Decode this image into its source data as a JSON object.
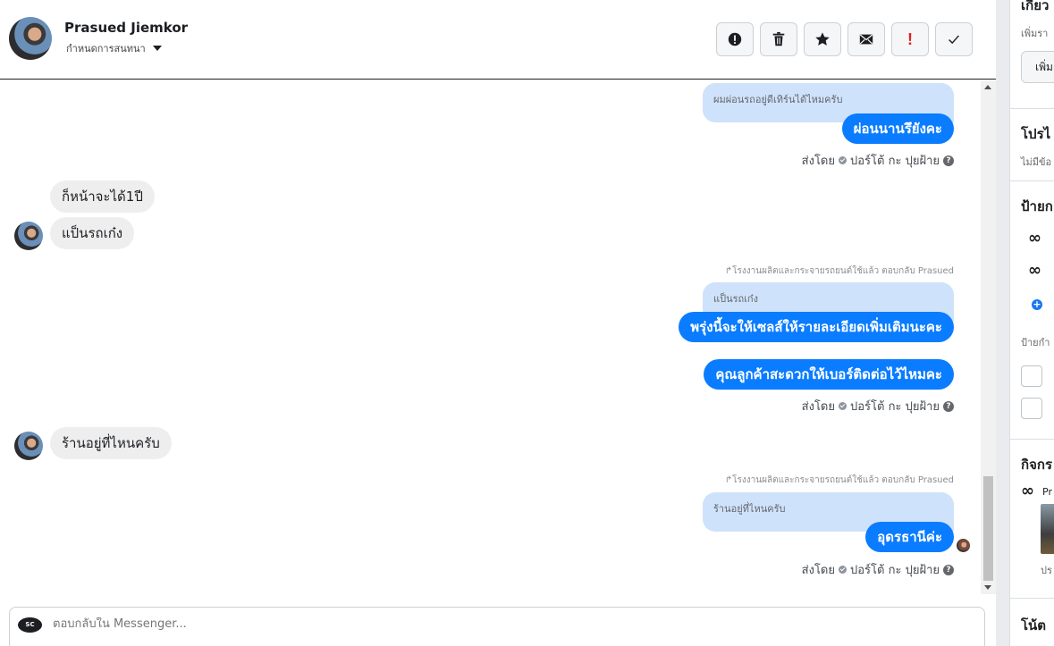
{
  "header": {
    "contact_name": "Prasued Jiemkor",
    "assign_label": "กำหนดการสนทนา"
  },
  "toolbar": {
    "buttons": [
      {
        "name": "spam-button",
        "icon": "alert-circle-icon"
      },
      {
        "name": "delete-button",
        "icon": "trash-icon"
      },
      {
        "name": "star-button",
        "icon": "star-icon"
      },
      {
        "name": "mark-unread-button",
        "icon": "envelope-icon"
      },
      {
        "name": "follow-up-button",
        "icon": "exclamation-icon",
        "label": "!"
      },
      {
        "name": "mark-done-button",
        "icon": "check-icon"
      }
    ]
  },
  "thread": {
    "quote_1": "ผมผ่อนรถอยู่ดีเทิร์นได้ไหมครับ",
    "msg_out_1": "ผ่อนนานรึยังคะ",
    "sent_by_prefix": "ส่งโดย",
    "sent_by_name": "ปอร์โต้ กะ ปุยฝ้าย",
    "msg_in_1": "ก็หน้าจะได้1ปี",
    "msg_in_2": "แป็นรถเก๋ง",
    "reply_label_1": "โรงงานผลิตและกระจายรถยนต์ใช้แล้ว ตอบกลับ Prasued",
    "quote_2": "แป็นรถเก๋ง",
    "msg_out_2": "พรุ่งนี้จะให้เซลส์ให้รายละเอียดเพิ่มเติมนะคะ",
    "msg_out_3": "คุณลูกค้าสะดวกให้เบอร์ติดต่อไว้ไหมคะ",
    "msg_in_3": "ร้านอยู่ที่ไหนครับ",
    "reply_label_2": "โรงงานผลิตและกระจายรถยนต์ใช้แล้ว ตอบกลับ Prasued",
    "quote_3": "ร้านอยู่ที่ไหนครับ",
    "msg_out_4": "อุดรธานีค่ะ"
  },
  "composer": {
    "placeholder": "ตอบกลับใน Messenger..."
  },
  "right_panel": {
    "section_1_title": "เกี่ยว",
    "section_1_sub": "เพิ่มรา",
    "section_1_btn": "เพิ่ม",
    "section_2_title": "โปรไ",
    "section_2_sub": "ไม่มีข้อ",
    "section_3_title": "ป้ายก",
    "label_sub": "ป้ายกำ",
    "section_4_title": "กิจกร",
    "activity_name": "Pr",
    "activity_caption": "ปร",
    "section_5_title": "โน้ต"
  }
}
